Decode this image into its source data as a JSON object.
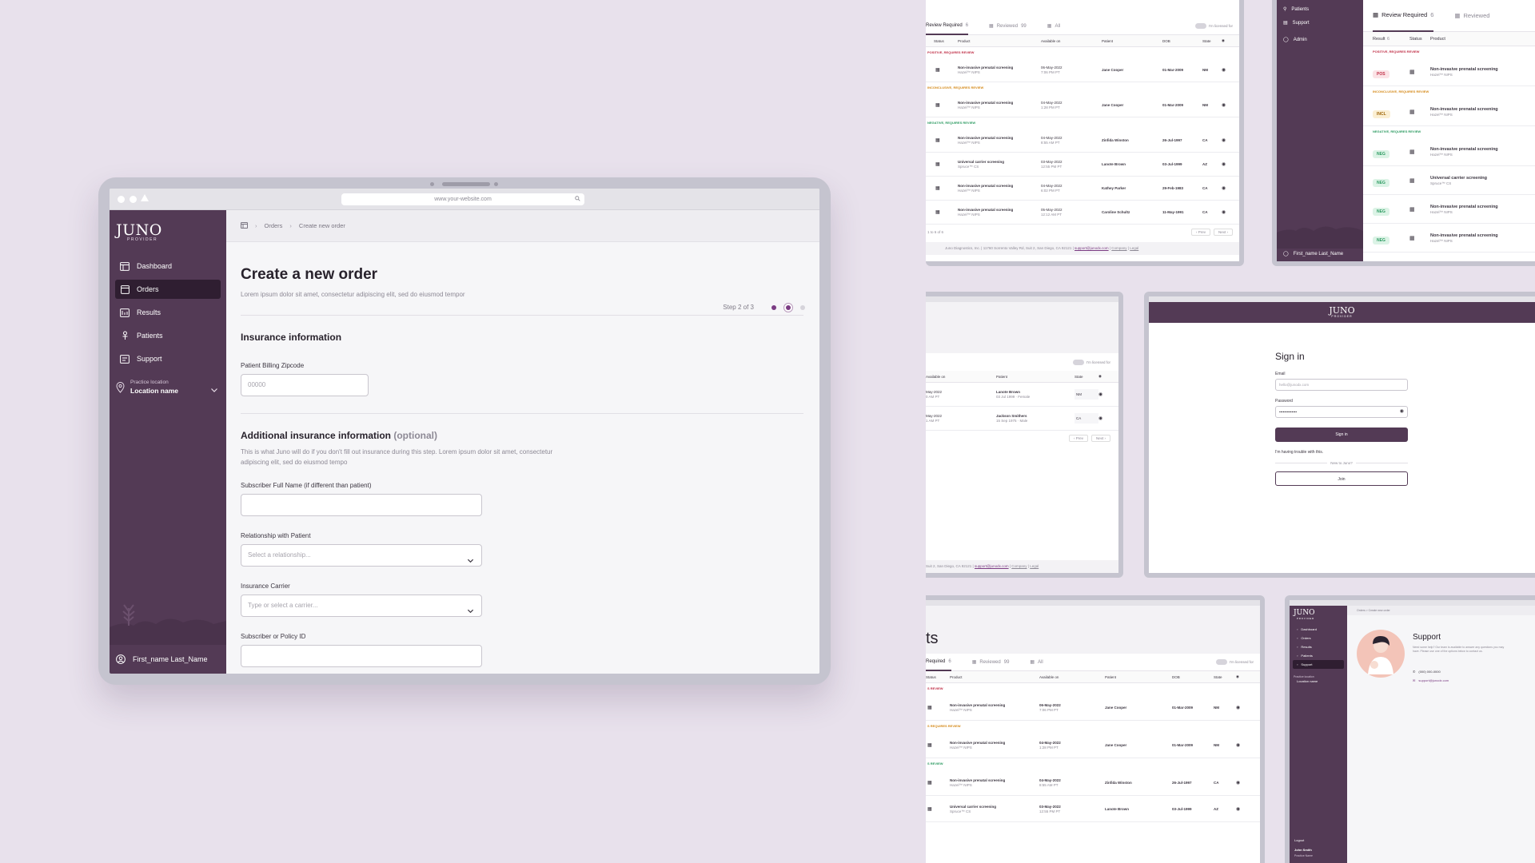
{
  "browser": {
    "url": "www.your-website.com"
  },
  "logo": {
    "brand": "JUNO",
    "sub": "PROVIDER"
  },
  "sidebar": {
    "items": [
      {
        "label": "Dashboard"
      },
      {
        "label": "Orders"
      },
      {
        "label": "Results"
      },
      {
        "label": "Patients"
      },
      {
        "label": "Support"
      }
    ],
    "location_label": "Practice location",
    "location_name": "Location name",
    "user_name": "First_name Last_Name"
  },
  "breadcrumb": {
    "orders": "Orders",
    "current": "Create new order"
  },
  "page": {
    "title": "Create a new order",
    "subtitle": "Lorem ipsum dolor sit amet, consectetur adipiscing elit, sed do eiusmod tempor",
    "step": "Step 2 of 3"
  },
  "insurance": {
    "title": "Insurance information",
    "zip_label": "Patient Billing Zipcode",
    "zip_placeholder": "00000"
  },
  "additional": {
    "title": "Additional insurance information",
    "optional": "(optional)",
    "desc": "This is what Juno will do if you don't fill out insurance during this step. Lorem ipsum dolor sit amet, consectetur adipiscing elit, sed do eiusmod tempo",
    "subscriber_label": "Subscriber Full Name (if different than patient)",
    "relationship_label": "Relationship with Patient",
    "relationship_placeholder": "Select a relationship...",
    "carrier_label": "Insurance Carrier",
    "carrier_placeholder": "Type or select a carrier...",
    "policy_label": "Subscriber or Policy ID"
  },
  "thumb_results": {
    "tab_review": "Review Required",
    "tab_review_count": "6",
    "tab_reviewed": "Reviewed",
    "tab_reviewed_count": "99",
    "tab_all": "All",
    "toggle_label": "I'm licensed for",
    "headers": [
      "Status",
      "Product",
      "Available on",
      "Patient",
      "DOB",
      "State"
    ],
    "groups": [
      "POSITIVE, REQUIRES REVIEW",
      "INCONCLUSIVE, REQUIRES REVIEW",
      "NEGATIVE, REQUIRES REVIEW"
    ],
    "rows": [
      {
        "product": "Non-invasive prenatal screening",
        "sub": "Hazel™ NIPS",
        "date": "06-May-2022",
        "time": "7:06 PM PT",
        "patient": "Jane Cooper",
        "dob": "01-Mar-2009",
        "state": "NM"
      },
      {
        "product": "Non-invasive prenatal screening",
        "sub": "Hazel™ NIPS",
        "date": "04-May-2022",
        "time": "1:28 PM PT",
        "patient": "Jane Cooper",
        "dob": "01-Mar-2009",
        "state": "NM"
      },
      {
        "product": "Non-invasive prenatal screening",
        "sub": "Hazel™ NIPS",
        "date": "04-May-2022",
        "time": "8:55 AM PT",
        "patient": "Zinfida Winston",
        "dob": "26-Jul-1997",
        "state": "CA"
      },
      {
        "product": "Universal carrier screening",
        "sub": "Spruce™ CS",
        "date": "03-May-2022",
        "time": "12:55 PM PT",
        "patient": "Lanote Brown",
        "dob": "03-Jul-1999",
        "state": "AZ"
      },
      {
        "product": "Non-invasive prenatal screening",
        "sub": "Hazel™ NIPS",
        "date": "04-May-2022",
        "time": "6:02 PM PT",
        "patient": "Kathey Parker",
        "dob": "29-Feb-1983",
        "state": "CA"
      },
      {
        "product": "Non-invasive prenatal screening",
        "sub": "Hazel™ NIPS",
        "date": "05-May-2022",
        "time": "12:12 AM PT",
        "patient": "Caroline Schultz",
        "dob": "11-May-1991",
        "state": "CA"
      }
    ],
    "paging": "1 to 6 of 6",
    "prev": "Prev",
    "next": "Next",
    "footer": "Juno Diagnostics, Inc. | 11760 Sorrento Valley Rd, Suit 2, San Diego, CA 92121 |",
    "footer_email": "support@junodx.com",
    "footer_company": "Company",
    "footer_legal": "Legal"
  },
  "thumb_review": {
    "side_patients": "Patients",
    "side_support": "Support",
    "side_admin": "Admin",
    "user": "First_name Last_Name",
    "tab_review": "Review Required",
    "tab_review_count": "6",
    "tab_reviewed": "Reviewed",
    "headers": [
      "Result",
      "6",
      "Status",
      "Product"
    ],
    "groups": [
      "POSITIVE, REQUIRES REVIEW",
      "INCONCLUSIVE, REQUIRES REVIEW",
      "NEGATIVE, REQUIRES REVIEW"
    ],
    "rows": [
      {
        "tag": "POS",
        "product": "Non-invasive prenatal screening",
        "sub": "Hazel™ NIPS"
      },
      {
        "tag": "INCL",
        "product": "Non-invasive prenatal screening",
        "sub": "Hazel™ NIPS"
      },
      {
        "tag": "NEG",
        "product": "Non-invasive prenatal screening",
        "sub": "Hazel™ NIPS"
      },
      {
        "tag": "NEG",
        "product": "Universal carrier screening",
        "sub": "Spruce™ CS"
      },
      {
        "tag": "NEG",
        "product": "Non-invasive prenatal screening",
        "sub": "Hazel™ NIPS"
      },
      {
        "tag": "NEG",
        "product": "Non-invasive prenatal screening",
        "sub": "Hazel™ NIPS"
      }
    ]
  },
  "thumb_patients": {
    "toggle_label": "I'm licensed for",
    "headers": [
      "Available on",
      "Patient",
      "State"
    ],
    "rows": [
      {
        "date": "May-2022",
        "time": "0 AM PT",
        "patient": "Lanote Brown",
        "info": "03 Jul 1999 · Female",
        "state": "NM"
      },
      {
        "date": "May-2022",
        "time": "1 AM PT",
        "patient": "Jackson Smithers",
        "info": "15 Sep 1975 · Male",
        "state": "CA"
      }
    ],
    "prev": "Prev",
    "next": "Next",
    "footer": "Suit 2, San Diego, CA 92121 |",
    "footer_email": "support@junodx.com",
    "footer_company": "Company",
    "footer_legal": "Legal"
  },
  "thumb_signin": {
    "brand": "JUNO",
    "sub": "PROVIDER",
    "title": "Sign in",
    "email_label": "Email",
    "email_placeholder": "hello@junodx.com",
    "password_label": "Password",
    "password_value": "••••••••••••••",
    "button": "Sign in",
    "trouble": "I'm having trouble with this.",
    "new": "New to Juno?",
    "join": "Join"
  },
  "thumb_results2": {
    "title_tail": "ts",
    "tab_review": "Required",
    "tab_review_count": "6",
    "tab_reviewed": "Reviewed",
    "tab_reviewed_count": "99",
    "tab_all": "All",
    "toggle_label": "I'm licensed for",
    "headers": [
      "Status",
      "Product",
      "Available on",
      "Patient",
      "DOB",
      "State"
    ],
    "groups": [
      "S REVIEW",
      "S REQUIRES REVIEW",
      "S REVIEW"
    ],
    "rows": [
      {
        "product": "Non-invasive prenatal screening",
        "sub": "Hazel™ NIPS",
        "date": "06-May-2022",
        "time": "7:06 PM PT",
        "patient": "Jane Cooper",
        "dob": "01-Mar-2009",
        "state": "NM"
      },
      {
        "product": "Non-invasive prenatal screening",
        "sub": "Hazel™ NIPS",
        "date": "04-May-2022",
        "time": "1:28 PM PT",
        "patient": "Jane Cooper",
        "dob": "01-Mar-2009",
        "state": "NM"
      },
      {
        "product": "Non-invasive prenatal screening",
        "sub": "Hazel™ NIPS",
        "date": "04-May-2022",
        "time": "8:55 AM PT",
        "patient": "Zinfida Winston",
        "dob": "26-Jul-1997",
        "state": "CA"
      },
      {
        "product": "Universal carrier screening",
        "sub": "Spruce™ CS",
        "date": "03-May-2022",
        "time": "12:55 PM PT",
        "patient": "Lanote Brown",
        "dob": "03-Jul-1999",
        "state": "AZ"
      }
    ]
  },
  "thumb_support": {
    "brand": "JUNO",
    "sub": "PROVIDER",
    "nav": [
      "Dashboard",
      "Orders",
      "Results",
      "Patients",
      "Support"
    ],
    "loc_label": "Practice location",
    "loc_name": "Location name",
    "crumb": "Orders  >  Create new order",
    "title": "Support",
    "desc": "Need some help? Our team is available to answer any questions you may have. Please use one of the options below to contact us.",
    "phone": "(000) 000-0000",
    "email": "support@junodx.com",
    "logout": "Logout",
    "user": "John Smith",
    "user_role": "Practice Name"
  },
  "colors": {
    "sidebar": "#533a55",
    "accent": "#7b3c83",
    "background": "#e8e1ec"
  }
}
